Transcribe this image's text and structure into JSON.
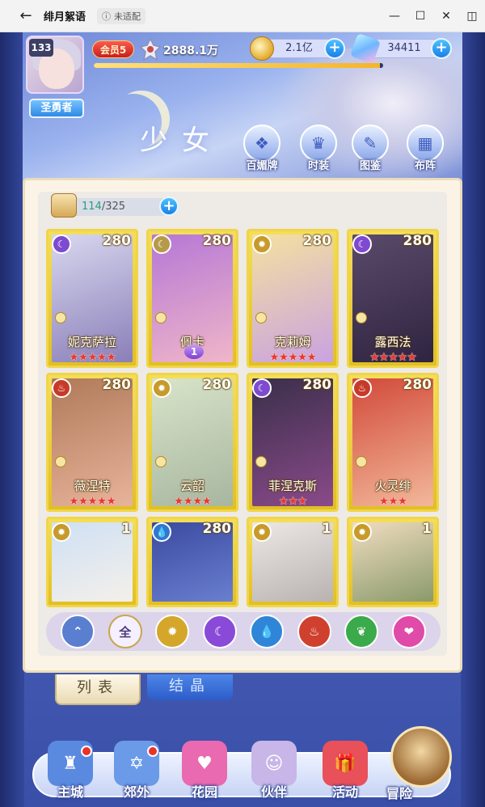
{
  "titlebar": {
    "title": "绯月絮语",
    "badge": "未适配",
    "minimize": "—",
    "maximize": "☐",
    "close": "✕",
    "snap": "◫"
  },
  "header": {
    "player_level": "133",
    "rank": "圣勇者",
    "vip": "会员5",
    "power": "2888.1万",
    "gold": "2.1亿",
    "gems": "34411",
    "exp_fraction": 0.99,
    "page_title": "少女",
    "buttons": [
      {
        "label": "百媚牌",
        "icon": "cards-icon"
      },
      {
        "label": "时装",
        "icon": "costume-icon"
      },
      {
        "label": "图鉴",
        "icon": "codex-icon"
      },
      {
        "label": "布阵",
        "icon": "formation-icon"
      }
    ]
  },
  "roster": {
    "current": "114",
    "separator": "/",
    "max": "325"
  },
  "cards": [
    {
      "name": "妮克萨拉",
      "level": "280",
      "stars": "★★★★★",
      "element": "moon",
      "elem_color": "#7d4ad0",
      "art": [
        "#d8d7ef",
        "#8a7fb8"
      ]
    },
    {
      "name": "佩卡",
      "level": "280",
      "stars": "",
      "awaken": "1",
      "element": "moon",
      "elem_color": "#b69a4a",
      "art": [
        "#b577d6",
        "#f0b6c8"
      ]
    },
    {
      "name": "克莉姆",
      "level": "280",
      "stars": "★★★★★",
      "element": "sun",
      "elem_color": "#c79a2a",
      "art": [
        "#f4e1a0",
        "#c9a2e0"
      ]
    },
    {
      "name": "露西法",
      "level": "280",
      "stars": "★★★★★",
      "element": "moon",
      "elem_color": "#7d4ad0",
      "art": [
        "#5b4a6a",
        "#2e2440"
      ]
    },
    {
      "name": "薇涅特",
      "level": "280",
      "stars": "★★★★★",
      "element": "fire",
      "elem_color": "#c63a2a",
      "art": [
        "#b07a5a",
        "#e7b39a"
      ]
    },
    {
      "name": "云韶",
      "level": "280",
      "stars": "★★★★",
      "element": "sun",
      "elem_color": "#c79a2a",
      "art": [
        "#d9e4c9",
        "#a7b6a0"
      ]
    },
    {
      "name": "菲涅克斯",
      "level": "280",
      "stars": "★★★",
      "element": "moon",
      "elem_color": "#7d4ad0",
      "art": [
        "#3a2f4a",
        "#8a4a8a"
      ]
    },
    {
      "name": "火灵绯",
      "level": "280",
      "stars": "★★★",
      "element": "fire",
      "elem_color": "#c63a2a",
      "art": [
        "#d24a3a",
        "#f2b89a"
      ]
    },
    {
      "name": "",
      "level": "1",
      "stars": "",
      "element": "sun",
      "elem_color": "#c79a2a",
      "art": [
        "#cfe0f4",
        "#f4f0ea"
      ]
    },
    {
      "name": "",
      "level": "280",
      "stars": "",
      "element": "water",
      "elem_color": "#2f78d0",
      "art": [
        "#3a4aa0",
        "#6a7fd0"
      ]
    },
    {
      "name": "",
      "level": "1",
      "stars": "",
      "element": "sun",
      "elem_color": "#c79a2a",
      "art": [
        "#ece8e6",
        "#b9b2b0"
      ]
    },
    {
      "name": "",
      "level": "1",
      "stars": "",
      "element": "sun",
      "elem_color": "#c79a2a",
      "art": [
        "#f0dcc0",
        "#8a9a6a"
      ]
    }
  ],
  "filters": [
    {
      "name": "filter-wind",
      "label": "⌃",
      "color": "#5a7fd0"
    },
    {
      "name": "filter-all",
      "label": "全",
      "color": "#f4f0ff"
    },
    {
      "name": "filter-sun",
      "label": "✹",
      "color": "#d4a62a"
    },
    {
      "name": "filter-moon",
      "label": "☾",
      "color": "#8a4ad8"
    },
    {
      "name": "filter-water",
      "label": "💧",
      "color": "#2f86d8"
    },
    {
      "name": "filter-fire",
      "label": "♨",
      "color": "#d0402e"
    },
    {
      "name": "filter-nature",
      "label": "❦",
      "color": "#3aaa4a"
    },
    {
      "name": "filter-heart",
      "label": "❤",
      "color": "#e04aa8"
    }
  ],
  "tabs": {
    "list": "列表",
    "crystal": "结晶"
  },
  "nav": [
    {
      "label": "主城",
      "icon": "castle-icon",
      "color": "#5a8ae0",
      "dot": true
    },
    {
      "label": "郊外",
      "icon": "outskirts-icon",
      "color": "#6a9ae8",
      "dot": true
    },
    {
      "label": "花园",
      "icon": "garden-icon",
      "color": "#e96ab0",
      "dot": false
    },
    {
      "label": "伙伴",
      "icon": "partner-icon",
      "color": "#c8b6e8",
      "dot": false
    },
    {
      "label": "活动",
      "icon": "gift-icon",
      "color": "#e8505a",
      "dot": false
    }
  ],
  "adventure": "冒险"
}
